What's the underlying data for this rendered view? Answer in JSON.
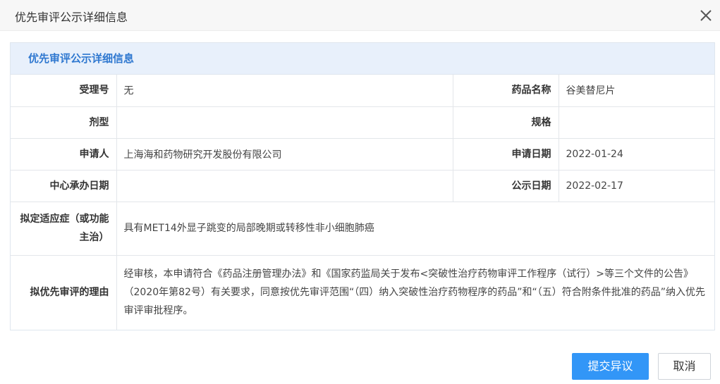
{
  "dialog": {
    "title": "优先审评公示详细信息"
  },
  "panel": {
    "heading": "优先审评公示详细信息"
  },
  "fields": {
    "acceptance_no": {
      "label": "受理号",
      "value": "无"
    },
    "drug_name": {
      "label": "药品名称",
      "value": "谷美替尼片"
    },
    "dosage_form": {
      "label": "剂型",
      "value": ""
    },
    "specification": {
      "label": "规格",
      "value": ""
    },
    "applicant": {
      "label": "申请人",
      "value": "上海海和药物研究开发股份有限公司"
    },
    "apply_date": {
      "label": "申请日期",
      "value": "2022-01-24"
    },
    "center_date": {
      "label": "中心承办日期",
      "value": ""
    },
    "publish_date": {
      "label": "公示日期",
      "value": "2022-02-17"
    },
    "indication": {
      "label": "拟定适应症（或功能主治）",
      "value": "具有MET14外显子跳变的局部晚期或转移性非小细胞肺癌"
    },
    "reason": {
      "label": "拟优先审评的理由",
      "value": "经审核，本申请符合《药品注册管理办法》和《国家药监局关于发布<突破性治疗药物审评工作程序（试行）>等三个文件的公告》（2020年第82号）有关要求，同意按优先审评范围“（四）纳入突破性治疗药物程序的药品”和“（五）符合附条件批准的药品”纳入优先审评审批程序。"
    }
  },
  "buttons": {
    "submit_objection": "提交异议",
    "cancel": "取消"
  },
  "icons": {
    "close": "close-icon"
  },
  "colors": {
    "accent": "#3296f7",
    "heading": "#2f78d0",
    "heading_bg": "#e8f0fb"
  }
}
